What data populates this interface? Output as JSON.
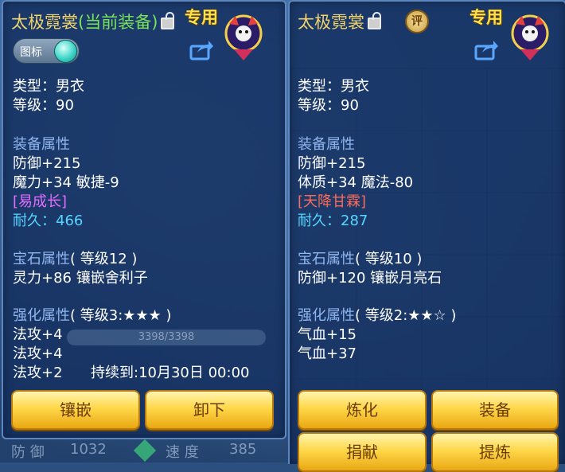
{
  "left": {
    "title": "太极霓裳",
    "title_suffix": "(当前装备)",
    "badge": "专用",
    "toggle_label": "图标",
    "type": "类型：男衣",
    "level": "等级：90",
    "attr_header": "装备属性",
    "attr1": "防御+215",
    "attr2": "魔力+34 敏捷-9",
    "special": "[易成长]",
    "durability_label": "耐久：",
    "durability_value": "466",
    "gem_header": "宝石属性",
    "gem_level": "( 等级12 )",
    "gem_attr": "灵力+86 镶嵌舍利子",
    "enh_header": "强化属性",
    "enh_level": "( 等级3:★★★ )",
    "enh1": "法攻+4",
    "enh2": "法攻+4",
    "enh3": "法攻+2",
    "enh_expire": "持续到:10月30日 00:00",
    "bg_bar": "3398/3398",
    "buttons": [
      "镶嵌",
      "卸下"
    ]
  },
  "right": {
    "title": "太极霓裳",
    "rate_label": "评",
    "badge": "专用",
    "type": "类型：男衣",
    "level": "等级：90",
    "attr_header": "装备属性",
    "attr1": "防御+215",
    "attr2": "体质+34 魔法-80",
    "special": "[天降甘霖]",
    "durability_label": "耐久：",
    "durability_value": "287",
    "gem_header": "宝石属性",
    "gem_level": "( 等级10 )",
    "gem_attr": "防御+120 镶嵌月亮石",
    "enh_header": "强化属性",
    "enh_level": "( 等级2:★★☆ )",
    "enh1": "气血+15",
    "enh2": "气血+37",
    "buttons": [
      "炼化",
      "装备",
      "捐献",
      "提炼"
    ]
  },
  "bottom_strip": {
    "label1": "防 御",
    "value1": "1032",
    "label2": "速 度",
    "value2": "385"
  },
  "colors": {
    "title": "#f2d36b",
    "current": "#7ae35a",
    "section": "#8fb6ee",
    "durability": "#56d6ff",
    "special_left": "#e46cff",
    "special_right": "#ff6a57",
    "button": "#ffd84a"
  }
}
